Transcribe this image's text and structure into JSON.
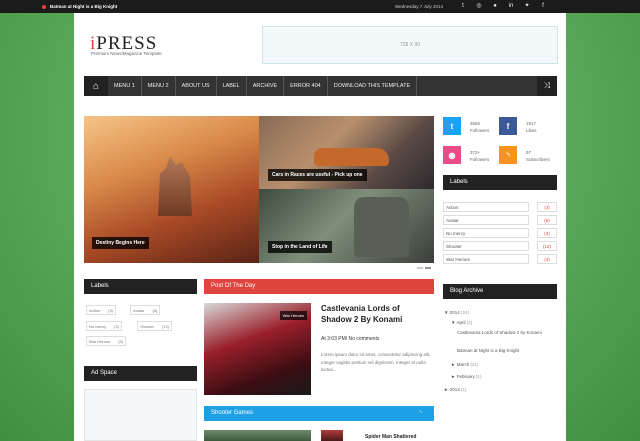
{
  "topbar": {
    "ticker": "Batman at Night is a Big Knight",
    "date": "Wednesday 7 July 2014",
    "social_icons": [
      "tumblr-icon",
      "instagram-icon",
      "github-icon",
      "linkedin-icon",
      "twitter-icon",
      "facebook-icon"
    ]
  },
  "header": {
    "logo": "PRESS",
    "logo_accent": "i",
    "tagline": "Premium News/Magazine Template",
    "ad_label": "728 X 90"
  },
  "nav": {
    "items": [
      "MENU 1",
      "MENU 2",
      "ABOUT US",
      "LABEL",
      "ARCHIVE",
      "ERROR 404",
      "DOWNLOAD THIS TEMPLATE"
    ]
  },
  "slider": {
    "big_caption": "Destiny Begins Here",
    "top_caption": "Cars in Races are useful - Pick up one",
    "bottom_caption": "Stop in the Land of Life"
  },
  "social_counters": [
    {
      "icon": "twitter-icon",
      "count": "3585",
      "unit": "Followers",
      "color": "#1da1f2"
    },
    {
      "icon": "facebook-icon",
      "count": "1917",
      "unit": "Likes",
      "color": "#3b5998"
    },
    {
      "icon": "dribbble-icon",
      "count": "372+",
      "unit": "Followers",
      "color": "#ea4c89"
    },
    {
      "icon": "rss-icon",
      "count": "97",
      "unit": "Subscribers",
      "color": "#f7931e"
    }
  ],
  "labels_right": {
    "title": "Labels",
    "items": [
      {
        "name": "Action",
        "count": "(3)"
      },
      {
        "name": "Avatar",
        "count": "(6)"
      },
      {
        "name": "No mercy",
        "count": "(3)"
      },
      {
        "name": "Shooter",
        "count": "(12)"
      },
      {
        "name": "War Heroes",
        "count": "(3)"
      }
    ]
  },
  "labels_left": {
    "title": "Labels",
    "chips": [
      {
        "name": "Action",
        "count": "(3)"
      },
      {
        "name": "Avatar",
        "count": "(6)"
      },
      {
        "name": "No mercy",
        "count": "(3)"
      },
      {
        "name": "Shooter",
        "count": "(12)"
      },
      {
        "name": "War Heroes",
        "count": "(3)"
      }
    ]
  },
  "ad_space": {
    "title": "Ad Space"
  },
  "post_of_day": {
    "title": "Post Of The Day",
    "tag": "War Heroes",
    "post_title": "Castlevania Lords of Shadow 2 By Konami",
    "meta": "At 3:03 PM/ No comments",
    "excerpt": "Lorem ipsum dolor sit amet, consectetur adipiscing elit. Integer sagittis pretium vel dignissim. Integer at nulla luctus..."
  },
  "shooter_games": {
    "title": "Shooter Games",
    "first_title": "Spider Man Shattered"
  },
  "blog_archive": {
    "title": "Blog Archive",
    "year1": "2014",
    "year1_count": "(24)",
    "month1": "April",
    "month1_count": "(2)",
    "post1": "Castlevania Lords of Shadow 2 by Konami",
    "post2": "Batman at Night is a Big Knight",
    "month2": "March",
    "month2_count": "(21)",
    "month3": "February",
    "month3_count": "(1)",
    "year2": "2013",
    "year2_count": "(1)"
  }
}
